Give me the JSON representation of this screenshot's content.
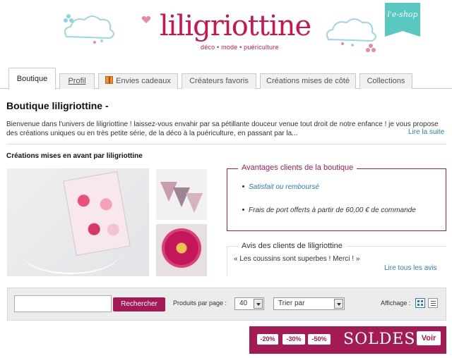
{
  "header": {
    "logo": "liligriottine",
    "tagline": "déco • mode • puériculture",
    "eshop_badge": "l'e-shop"
  },
  "tabs": [
    {
      "label": "Boutique"
    },
    {
      "label": "Profil"
    },
    {
      "label": "Envies cadeaux"
    },
    {
      "label": "Créateurs favoris"
    },
    {
      "label": "Créations mises de côté"
    },
    {
      "label": "Collections"
    }
  ],
  "shop": {
    "title": "Boutique liligriottine -",
    "description": "Bienvenue dans l'univers de liligriottine ! laissez-vous envahir par sa pétillante douceur venue tout droit de notre enfance ! je vous propose des créations uniques ou en très petite série, de la déco à la puériculture, en passant par la...",
    "read_more": "Lire la suite",
    "featured_title": "Créations mises en avant par liligriottine"
  },
  "advantages": {
    "title": "Avantages clients de la boutique",
    "items": [
      "Satisfait ou remboursé",
      "Frais de port offerts à partir de 60,00 € de commande"
    ]
  },
  "reviews": {
    "title": "Avis des clients de liligriottine",
    "quote": "« Les coussins sont superbes ! Merci ! »",
    "all_link": "Lire tous les avis"
  },
  "toolbar": {
    "search_value": "",
    "search_button": "Rechercher",
    "per_page_label": "Produits par page :",
    "per_page_value": "40",
    "sort_value": "Trier par",
    "view_label": "Affichage :"
  },
  "sales": {
    "tags": [
      "-20%",
      "-30%",
      "-50%"
    ],
    "text": "SOLDES",
    "button": "Voir"
  },
  "colors": {
    "brand": "#c8174e",
    "accent": "#a31a55",
    "link": "#2a7fae",
    "eshop": "#58c8c0"
  }
}
